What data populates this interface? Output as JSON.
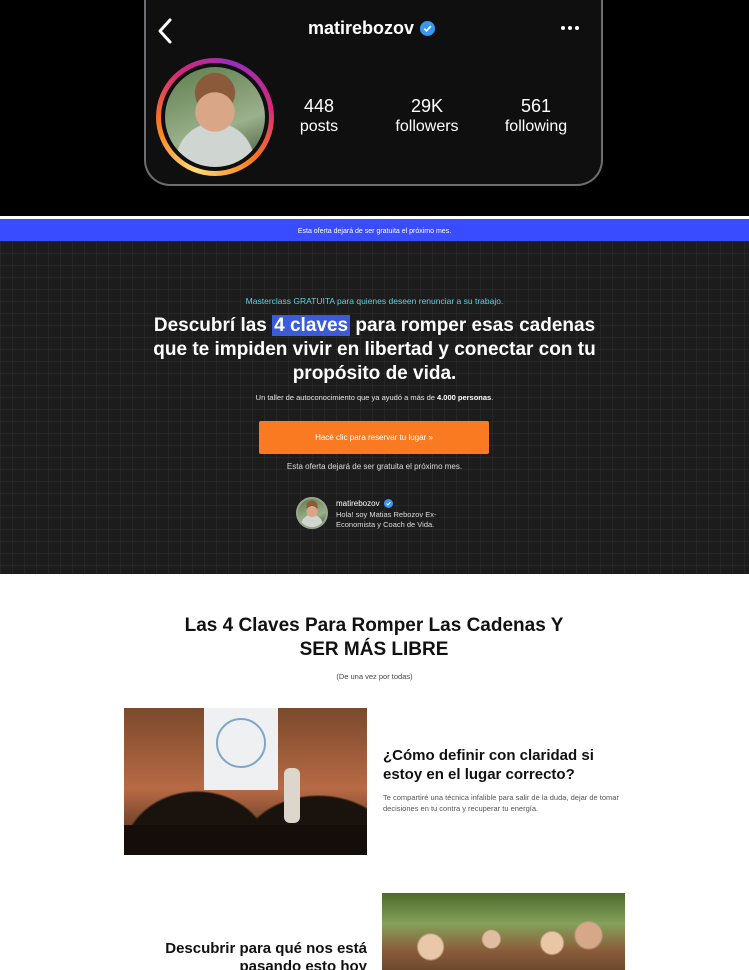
{
  "instagram": {
    "username": "matirebozov",
    "stats": [
      {
        "value": "448",
        "label": "posts"
      },
      {
        "value": "29K",
        "label": "followers"
      },
      {
        "value": "561",
        "label": "following"
      }
    ]
  },
  "topbar": {
    "text": "Esta oferta dejará de ser gratuita el próximo mes."
  },
  "hero": {
    "kicker": "Masterclass GRATUITA para quienes deseen renunciar a su trabajo.",
    "title_before": "Descubrí las ",
    "title_highlight": "4 claves",
    "title_after": " para romper esas cadenas que te impiden vivir en libertad y conectar con tu propósito de vida.",
    "sub_before": "Un taller de autoconocimiento que ya ayudó a más de ",
    "sub_bold": "4.000 personas",
    "sub_after": ".",
    "cta_label": "Hacé clic para reservar tu lugar »",
    "note": "Esta oferta dejará de ser gratuita el próximo mes.",
    "author_name": "matirebozov",
    "author_bio": "Hola! soy Matias Rebozov Ex-Economista y Coach de Vida."
  },
  "section": {
    "title": "Las 4 Claves Para Romper Las Cadenas Y SER MÁS LIBRE",
    "subtitle": "(De una vez por todas)",
    "card1_question": "¿Cómo definir con claridad si estoy en el lugar correcto?",
    "card1_desc": "Te compartiré una técnica infalible para salir de la duda, dejar de tomar decisiones en tu contra y recuperar tu energía.",
    "card2_question": "Descubrir para qué nos está pasando esto hoy"
  },
  "colors": {
    "accent_blue": "#3a4cff",
    "cta_orange": "#fa7a22",
    "kicker_cyan": "#5fd1de"
  }
}
